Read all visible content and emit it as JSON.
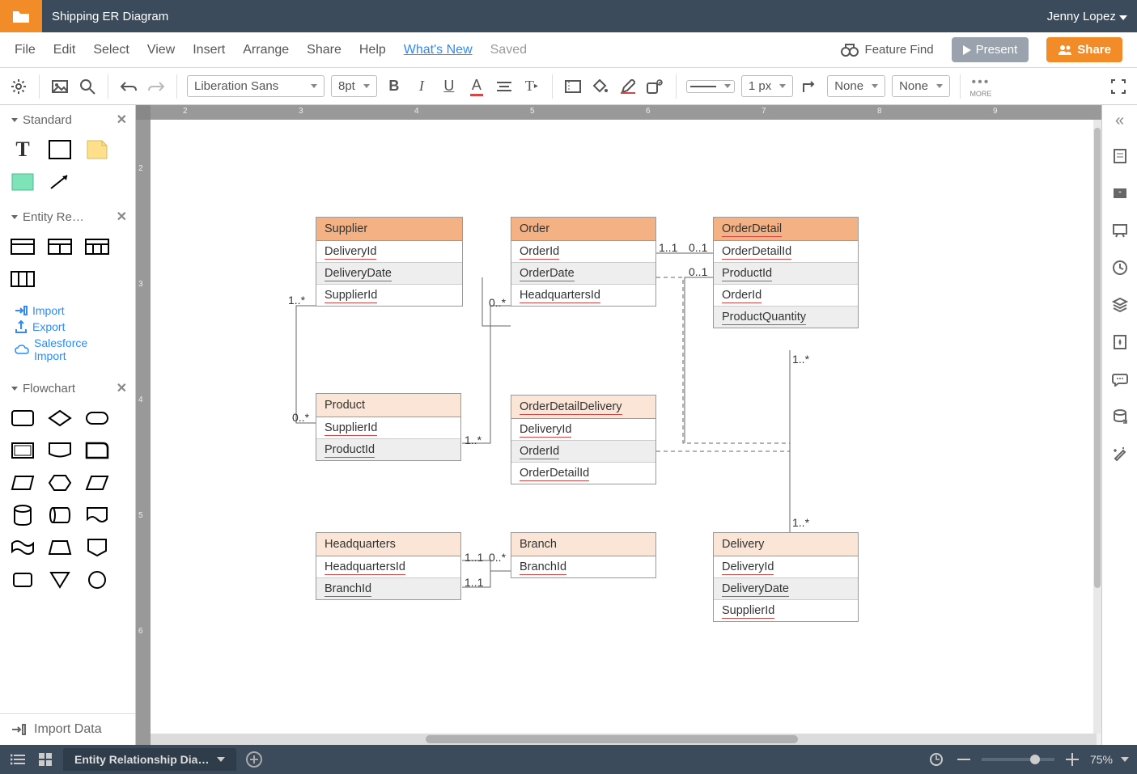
{
  "titlebar": {
    "doc_title": "Shipping ER Diagram",
    "user": "Jenny Lopez"
  },
  "menubar": {
    "file": "File",
    "edit": "Edit",
    "select": "Select",
    "view": "View",
    "insert": "Insert",
    "arrange": "Arrange",
    "share": "Share",
    "help": "Help",
    "whatsnew": "What's New",
    "saved": "Saved",
    "feature_find": "Feature Find",
    "present": "Present",
    "share_btn": "Share"
  },
  "toolbar": {
    "font": "Liberation Sans",
    "font_size": "8pt",
    "line_width": "1 px",
    "fill": "None",
    "stroke": "None",
    "more": "MORE"
  },
  "left": {
    "standard": "Standard",
    "entity": "Entity Re…",
    "flowchart": "Flowchart",
    "import": "Import",
    "export": "Export",
    "salesforce": "Salesforce Import",
    "import_data": "Import Data"
  },
  "canvas": {
    "entities": {
      "supplier": {
        "title": "Supplier",
        "fields": [
          "DeliveryId",
          "DeliveryDate",
          "SupplierId"
        ]
      },
      "product": {
        "title": "Product",
        "fields": [
          "SupplierId",
          "ProductId"
        ]
      },
      "headquarters": {
        "title": "Headquarters",
        "fields": [
          "HeadquartersId",
          "BranchId"
        ]
      },
      "order": {
        "title": "Order",
        "fields": [
          "OrderId",
          "OrderDate",
          "HeadquartersId"
        ]
      },
      "odd": {
        "title": "OrderDetailDelivery",
        "fields": [
          "DeliveryId",
          "OrderId",
          "OrderDetailId"
        ]
      },
      "branch": {
        "title": "Branch",
        "fields": [
          "BranchId"
        ]
      },
      "orderdetail": {
        "title": "OrderDetail",
        "fields": [
          "OrderDetailId",
          "ProductId",
          "OrderId",
          "ProductQuantity"
        ]
      },
      "delivery": {
        "title": "Delivery",
        "fields": [
          "DeliveryId",
          "DeliveryDate",
          "SupplierId"
        ]
      }
    },
    "cardinalities": {
      "c1": "1..*",
      "c2": "0..*",
      "c3": "1..*",
      "c4": "0..*",
      "c5": "1..1",
      "c6": "0..1",
      "c7": "0..1",
      "c8": "1..1",
      "c9": "0..*",
      "c10": "1..1",
      "c11": "1..*",
      "c12": "1..*"
    }
  },
  "tabbar": {
    "tab_name": "Entity Relationship Dia…",
    "zoom": "75%"
  }
}
